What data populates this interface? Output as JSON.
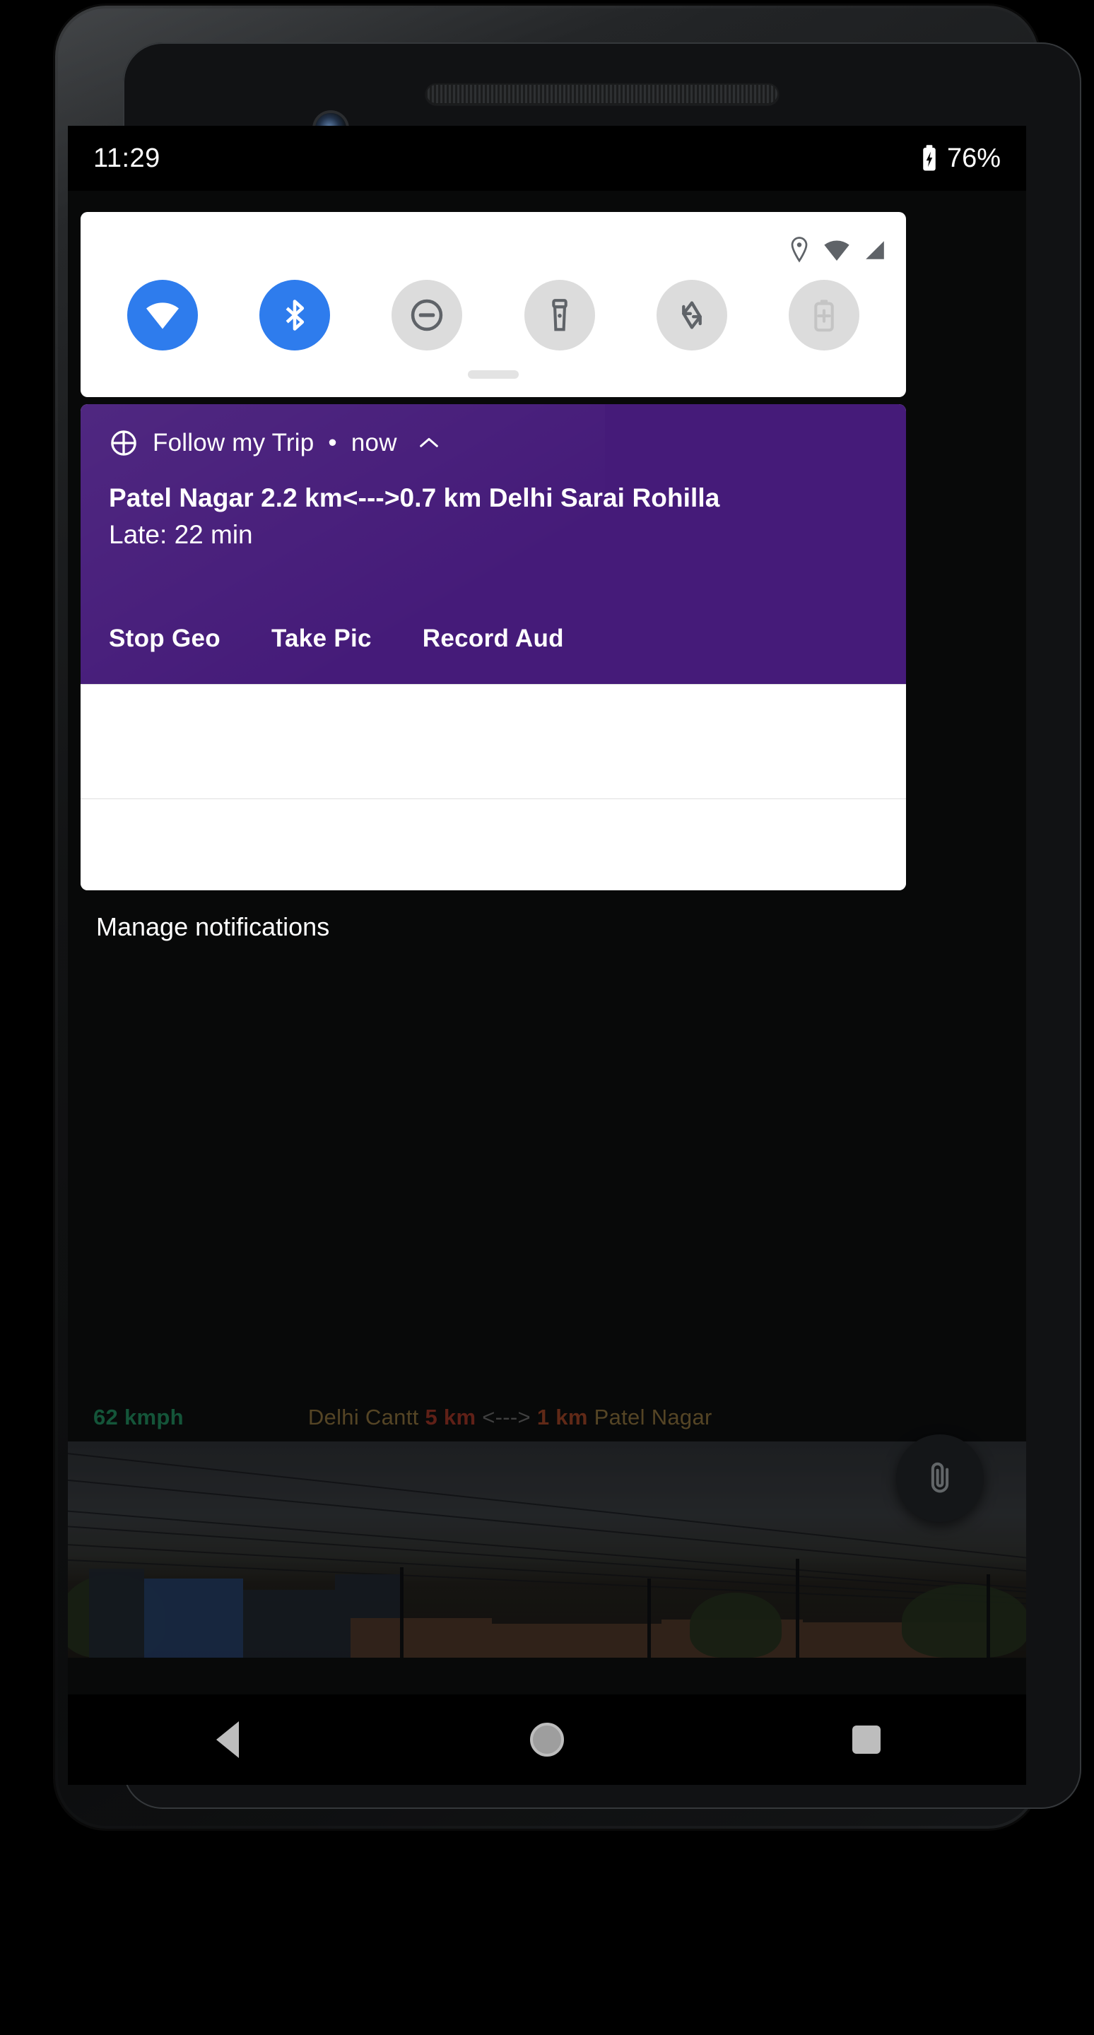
{
  "status_bar": {
    "time": "11:29",
    "battery_percent": "76%",
    "battery_icon": "battery-charging-icon"
  },
  "quick_settings": {
    "status_icons": [
      {
        "name": "location-icon"
      },
      {
        "name": "wifi-icon"
      },
      {
        "name": "cell-signal-icon"
      }
    ],
    "tiles": [
      {
        "name": "wifi-tile",
        "label": "Wi-Fi",
        "state": "on"
      },
      {
        "name": "bluetooth-tile",
        "label": "Bluetooth",
        "state": "on"
      },
      {
        "name": "do-not-disturb-tile",
        "label": "Do Not Disturb",
        "state": "off"
      },
      {
        "name": "flashlight-tile",
        "label": "Flashlight",
        "state": "off"
      },
      {
        "name": "auto-rotate-tile",
        "label": "Auto-rotate",
        "state": "off"
      },
      {
        "name": "battery-saver-tile",
        "label": "Battery Saver",
        "state": "off"
      }
    ],
    "drag_handle": "drag-handle"
  },
  "notification": {
    "app_name": "Follow my Trip",
    "separator": "•",
    "time": "now",
    "app_icon": "crosshair-globe-icon",
    "collapse_icon": "chevron-up-icon",
    "title": "Patel Nagar 2.2 km<--->0.7 km Delhi Sarai Rohilla",
    "subtitle": "Late: 22 min",
    "actions": [
      {
        "name": "stop-geo-action",
        "label": "Stop Geo"
      },
      {
        "name": "take-pic-action",
        "label": "Take Pic"
      },
      {
        "name": "record-aud-action",
        "label": "Record Aud"
      }
    ],
    "accent_color": "#451B79"
  },
  "shade": {
    "manage_label": "Manage notifications"
  },
  "background_app": {
    "speed": "62 kmph",
    "route": {
      "from_station": "Delhi Cantt",
      "from_distance": "5 km",
      "arrow": "<--->",
      "to_distance": "1 km",
      "to_station": "Patel Nagar"
    },
    "fab_icon": "paperclip-icon",
    "photo_alt": "city skyline with overhead power lines"
  },
  "nav_bar": {
    "back": "back-button",
    "home": "home-button",
    "recents": "recents-button"
  },
  "colors": {
    "notification_purple": "#451B79",
    "tile_active": "#2e7ced",
    "tile_inactive": "#dcdcdc",
    "speed_green": "#1d7a52",
    "distance_red": "#8a2f22",
    "station_tan": "#7a6336"
  }
}
